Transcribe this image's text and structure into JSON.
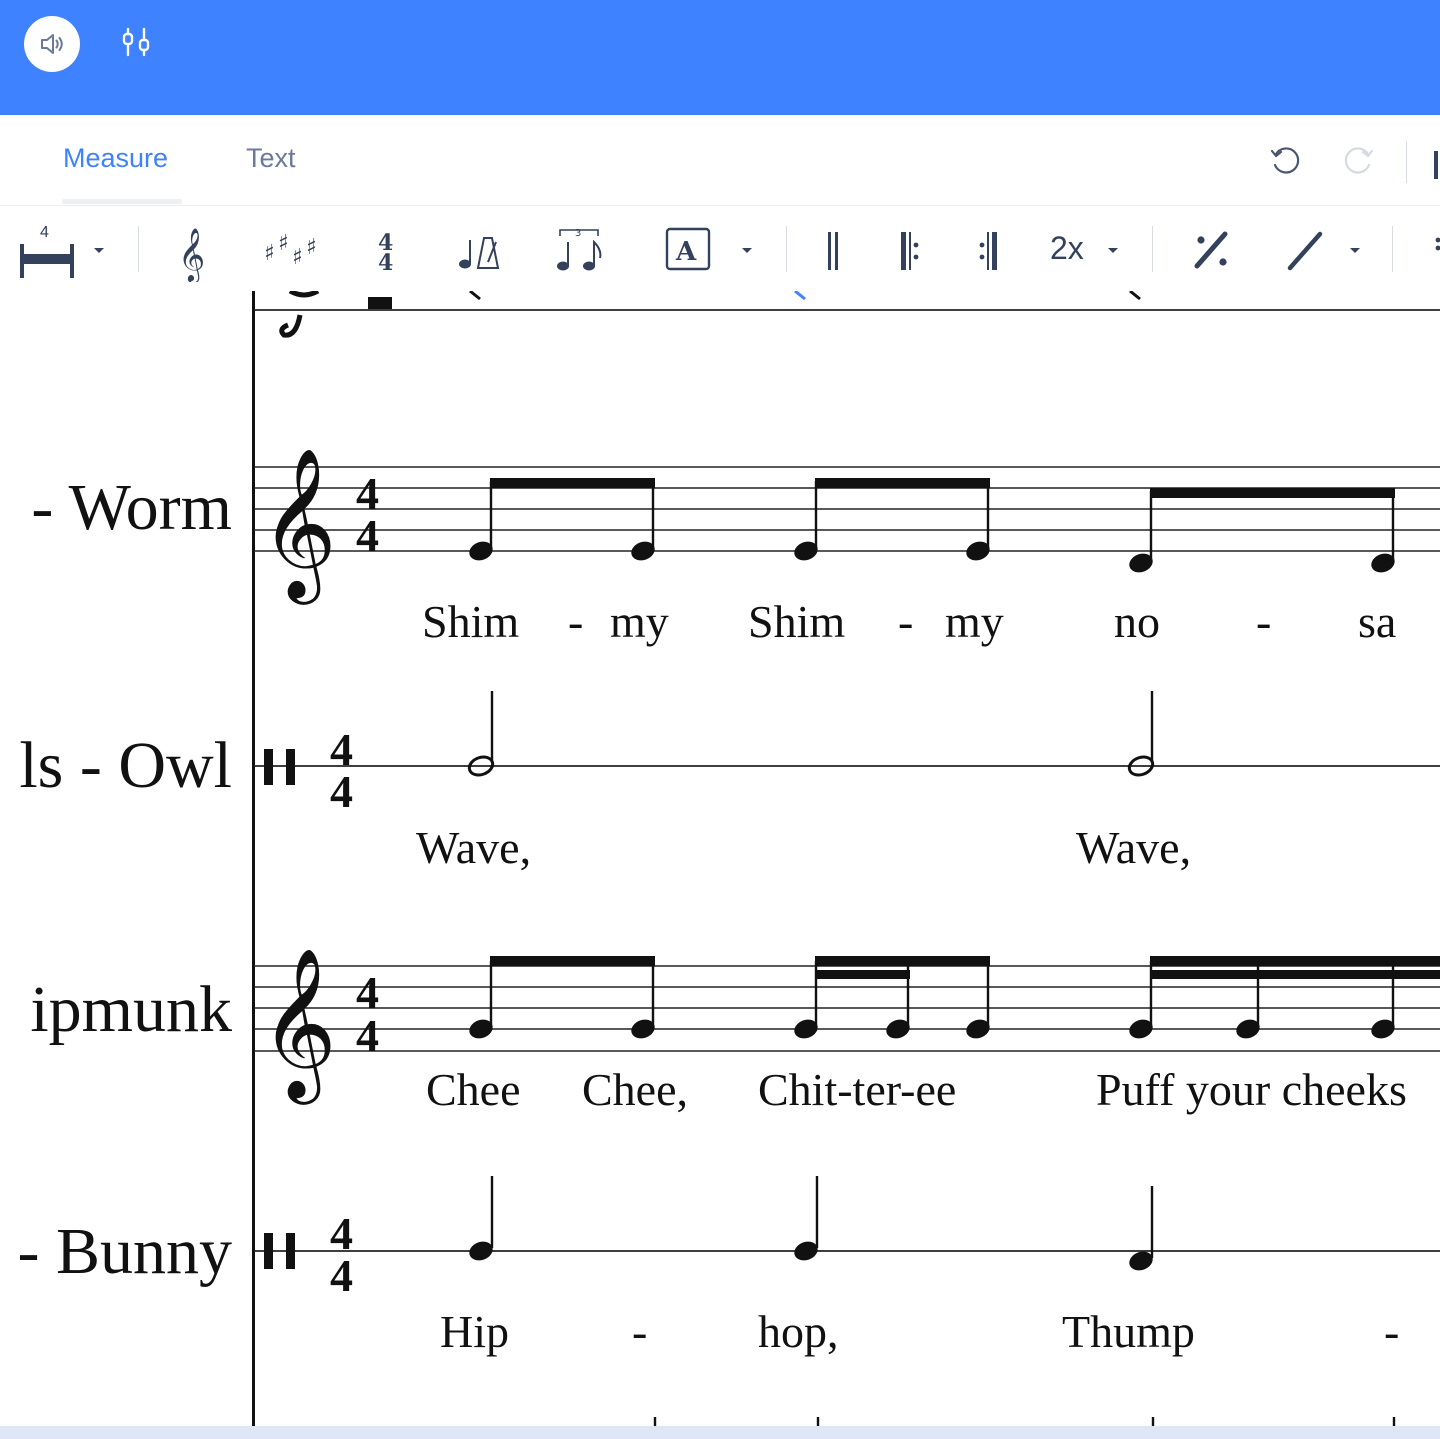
{
  "tabs": [
    {
      "label": "Measure",
      "active": true
    },
    {
      "label": "Text",
      "active": false
    }
  ],
  "toolbar": {
    "measures_count": "4",
    "repeat_times_label": "2x"
  },
  "colors": {
    "topbar": "#3f82ff",
    "tab_active": "#3f82ff",
    "tab_inactive": "#6b7a99",
    "icon": "#33415c"
  },
  "icons": [
    "speaker-icon",
    "mixer-icon",
    "undo-icon",
    "redo-icon",
    "measure-width-icon",
    "treble-clef-icon",
    "key-signature-icon",
    "time-signature-icon",
    "tempo-icon",
    "tuplet-icon",
    "text-box-icon",
    "double-barline-icon",
    "repeat-start-icon",
    "repeat-end-icon",
    "measure-repeat-icon",
    "slash-icon"
  ],
  "score": {
    "staves": [
      {
        "name": "- Worm",
        "clef": "treble",
        "time": "4/4",
        "lyrics": [
          "Shim",
          "-",
          "my",
          "Shim",
          "-",
          "my",
          "no",
          "-",
          "sa"
        ]
      },
      {
        "name": "ls - Owl",
        "clef": "percussion",
        "time": "4/4",
        "lyrics": [
          "Wave,",
          "Wave,"
        ]
      },
      {
        "name": "ipmunk",
        "clef": "treble",
        "time": "4/4",
        "lyrics": [
          "Chee",
          "Chee,",
          "Chit-ter-ee",
          "Puff your cheeks"
        ]
      },
      {
        "name": "- Bunny",
        "clef": "percussion",
        "time": "4/4",
        "lyrics": [
          "Hip",
          "-",
          "hop,",
          "Thump",
          "-"
        ]
      }
    ]
  }
}
